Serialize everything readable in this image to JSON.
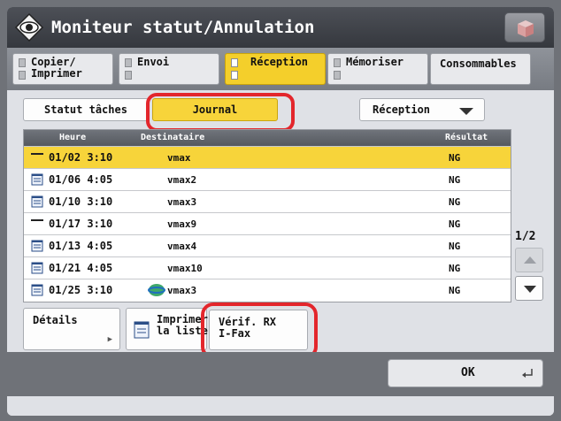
{
  "title": "Moniteur statut/Annulation",
  "tabs": [
    {
      "label": "Copier/\nImprimer",
      "active": false
    },
    {
      "label": "Envoi",
      "active": false
    },
    {
      "label": "Réception",
      "active": true
    },
    {
      "label": "Mémoriser",
      "active": false
    },
    {
      "label": "Consommables",
      "active": false
    }
  ],
  "toolbar": {
    "status_label": "Statut tâches",
    "journal_label": "Journal",
    "select_value": "Réception"
  },
  "table": {
    "headers": {
      "time": "Heure",
      "dest": "Destinataire",
      "result": "Résultat"
    },
    "rows": [
      {
        "time": "01/02 3:10",
        "dest": "vmax",
        "result": "NG",
        "icon": "dash-icon",
        "selected": true
      },
      {
        "time": "01/06 4:05",
        "dest": "vmax2",
        "result": "NG",
        "icon": "document-icon",
        "selected": false
      },
      {
        "time": "01/10 3:10",
        "dest": "vmax3",
        "result": "NG",
        "icon": "document-icon",
        "selected": false
      },
      {
        "time": "01/17 3:10",
        "dest": "vmax9",
        "result": "NG",
        "icon": "dash-icon",
        "selected": false
      },
      {
        "time": "01/13 4:05",
        "dest": "vmax4",
        "result": "NG",
        "icon": "document-icon",
        "selected": false
      },
      {
        "time": "01/21 4:05",
        "dest": "vmax10",
        "result": "NG",
        "icon": "document-icon",
        "selected": false
      },
      {
        "time": "01/25 3:10",
        "dest": "vmax3",
        "result": "NG",
        "icon": "document-icon",
        "selected": false
      }
    ]
  },
  "pager": {
    "text": "1/2"
  },
  "buttons": {
    "details": "Détails",
    "print_list": "Imprimer\nla liste",
    "verify_rx": "Vérif. RX\nI-Fax",
    "ok": "OK"
  },
  "colors": {
    "accent": "#f7d43a",
    "highlight_ring": "#e3262c"
  }
}
